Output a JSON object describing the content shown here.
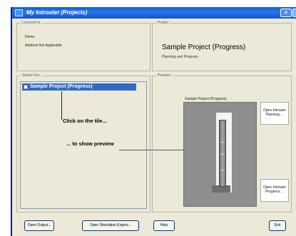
{
  "window": {
    "title": "My Introuter (Projects)",
    "close_glyph": "×"
  },
  "licensed": {
    "label": "Licensed to",
    "name": "Demo",
    "address": "Address Not Applicable"
  },
  "project": {
    "label": "Project",
    "title": "Sample Project (Progress)",
    "subtitle": "Planning and Progress"
  },
  "select": {
    "label": "Select One",
    "items": [
      {
        "label": "Sample Project (Progress)",
        "selected": true
      }
    ]
  },
  "annotations": {
    "click": "Click on the tile...",
    "show": "... to show preview"
  },
  "preview": {
    "label": "Preview",
    "image_label": "Sample Project (Progress)",
    "open_planning": "Open Introuter Planning ...",
    "open_progress": "Open Introuter Progress ..."
  },
  "buttons": {
    "open_output": "Open Output...",
    "open_sim": "Open Simulation Engine...",
    "help": "Help",
    "exit": "Exit"
  }
}
